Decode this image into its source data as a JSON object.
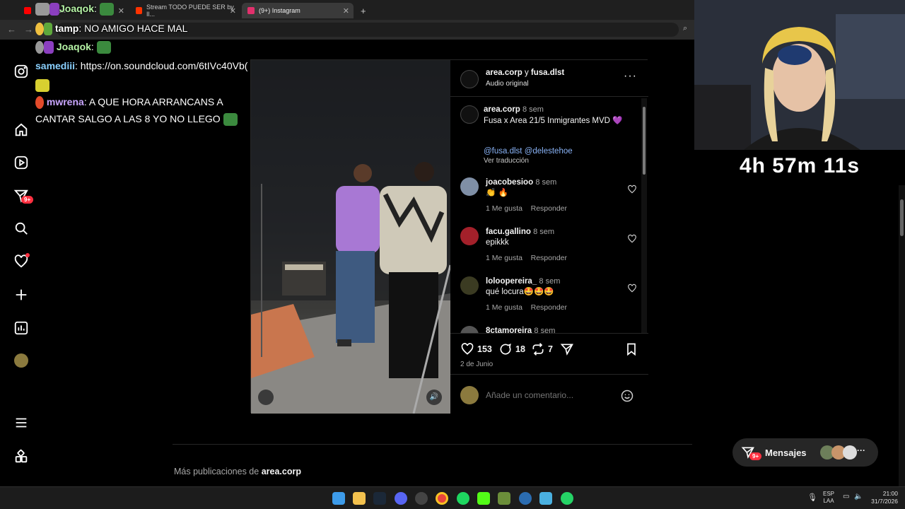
{
  "browser": {
    "tabs": [
      {
        "label": "(2) Joaqok",
        "icon": "youtube-icon",
        "color": "#ff0000"
      },
      {
        "label": "Stream TODO PUEDE SER by Il...",
        "icon": "youtube-icon",
        "color": "#ff3300"
      },
      {
        "label": "(9+) Instagram",
        "icon": "instagram-icon",
        "color": "#e1306c"
      }
    ],
    "new_tab": "+"
  },
  "chat": {
    "lines": [
      {
        "user": "Joaqok",
        "color": "#b7f5a7",
        "text": ":"
      },
      {
        "user": "tamp",
        "color": "#ffffff",
        "text": ": NO AMIGO HACE MAL"
      },
      {
        "user": "Joaqok",
        "color": "#b7f5a7",
        "text": ":"
      },
      {
        "user": "samediii",
        "color": "#8ad0ff",
        "text": ": https://on.soundcloud.com/6tIVc40Vb("
      },
      {
        "user": "mwrena",
        "color": "#c9a6ff",
        "text": ": A QUE HORA ARRANCANS A"
      },
      {
        "user": "",
        "color": "#ffffff",
        "text": "CANTAR SALGO A LAS 8 YO NO LLEGO"
      }
    ]
  },
  "nav": {
    "badge_notifications": "9+"
  },
  "post": {
    "header_user1": "area.corp",
    "header_joiner": " y ",
    "header_user2": "fusa.dlst",
    "header_audio": "Audio original",
    "caption_user": "area.corp",
    "caption_time": "8 sem",
    "caption_text": "Fusa x Area 21/5 Inmigrantes MVD",
    "caption_mentions": "@fusa.dlst @delestehoe",
    "caption_translate": "Ver traducción",
    "comments": [
      {
        "user": "joacobesioo",
        "time": "8 sem",
        "text": "👏 🔥",
        "likes": "1 Me gusta",
        "reply": "Responder"
      },
      {
        "user": "facu.gallino",
        "time": "8 sem",
        "text": "epikkk",
        "likes": "1 Me gusta",
        "reply": "Responder"
      },
      {
        "user": "loloopereira_",
        "time": "8 sem",
        "text": "qué locura🤩🤩🤩",
        "likes": "1 Me gusta",
        "reply": "Responder"
      },
      {
        "user": "8ctamoreira",
        "time": "8 sem",
        "text": "",
        "likes": "",
        "reply": ""
      }
    ],
    "likes_count": "153",
    "comments_count": "18",
    "reposts_count": "7",
    "date": "2 de Junio",
    "comment_placeholder": "Añade un comentario..."
  },
  "more": {
    "prefix": "Más publicaciones de ",
    "user": "area.corp"
  },
  "messages": {
    "label": "Mensajes",
    "badge": "9+"
  },
  "stream": {
    "timer": "4h 57m 11s"
  },
  "tray": {
    "lang1": "ESP",
    "lang2": "LAA",
    "time": "21:00",
    "date": "31/7/2026"
  },
  "colors": {
    "accent_blue": "#0095f6",
    "badge_red": "#ff3040",
    "link": "#8ab4f8"
  }
}
